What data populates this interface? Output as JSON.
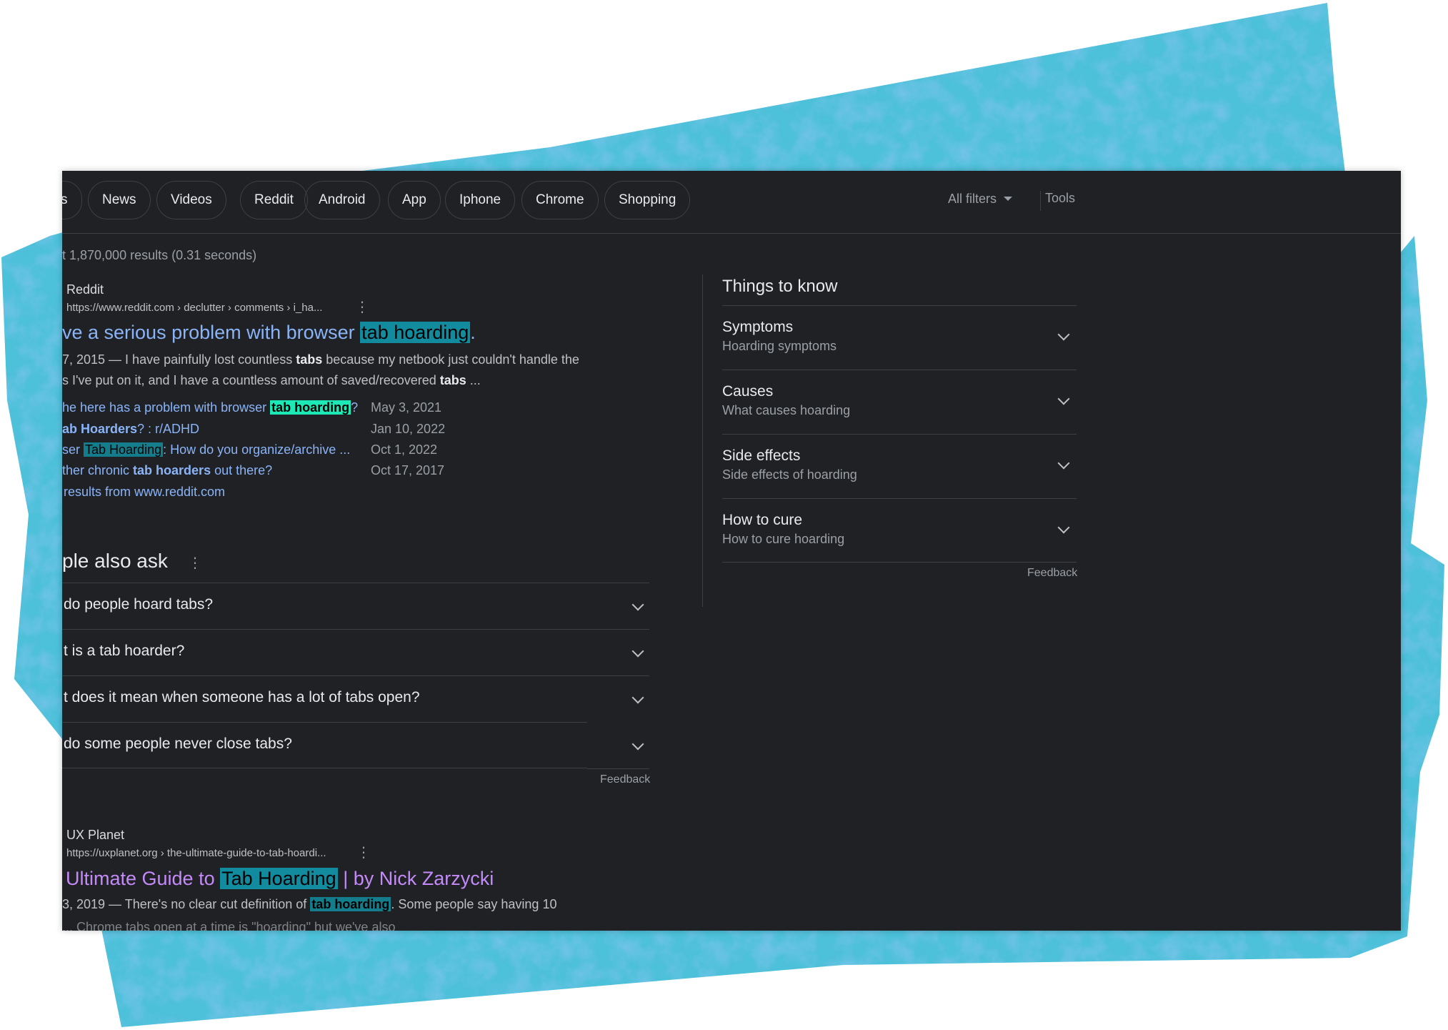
{
  "chips": [
    "s",
    "News",
    "Videos",
    "Reddit",
    "Android",
    "App",
    "Iphone",
    "Chrome",
    "Shopping"
  ],
  "toolbar": {
    "all_filters": "All filters",
    "tools": "Tools"
  },
  "result_stats": "t 1,870,000 results (0.31 seconds)",
  "result1": {
    "site": "Reddit",
    "url": "https://www.reddit.com › declutter › comments › i_ha...",
    "title_pre": "ve a serious problem with browser ",
    "title_hl": "tab hoarding",
    "title_post": ".",
    "snippet1_a": "7, 2015 — I have painfully lost countless ",
    "snippet1_b": "tabs",
    "snippet1_c": " because my netbook just couldn't handle the",
    "snippet2_a": "s I've put on it, and I have a countless amount of saved/recovered ",
    "snippet2_b": "tabs",
    "snippet2_c": " ...",
    "sublinks": [
      {
        "pre": "he here has a problem with browser ",
        "hl": "tab hoarding",
        "post": "?",
        "date": "May 3, 2021"
      },
      {
        "pre": "",
        "bold": "ab Hoarders",
        "post": "? : r/ADHD",
        "date": "Jan 10, 2022"
      },
      {
        "pre": "ser ",
        "hl": "Tab Hoarding",
        "post": ": How do you organize/archive ...",
        "date": "Oct 1, 2022"
      },
      {
        "pre": "ther chronic ",
        "bold": "tab hoarders",
        "post": " out there?",
        "date": "Oct 17, 2017"
      }
    ],
    "more": "results from www.reddit.com"
  },
  "paa": {
    "title": "ple also ask",
    "questions": [
      "do people hoard tabs?",
      "t is a tab hoarder?",
      "t does it mean when someone has a lot of tabs open?",
      "do some people never close tabs?"
    ],
    "feedback": "Feedback"
  },
  "result2": {
    "site": "UX Planet",
    "url": "https://uxplanet.org › the-ultimate-guide-to-tab-hoardi...",
    "title_pre": "Ultimate Guide to ",
    "title_hl": "Tab Hoarding",
    "title_post": " | by Nick Zarzycki",
    "snippet_a": "3, 2019 — There's no clear cut definition of ",
    "snippet_hl": "tab hoarding",
    "snippet_c": ". Some people say having 10",
    "snippet_cut": "... Chrome tabs open at a time is \"hoarding\" but we've also"
  },
  "things_to_know": {
    "title": "Things to know",
    "items": [
      {
        "heading": "Symptoms",
        "sub": "Hoarding symptoms"
      },
      {
        "heading": "Causes",
        "sub": "What causes hoarding"
      },
      {
        "heading": "Side effects",
        "sub": "Side effects of hoarding"
      },
      {
        "heading": "How to cure",
        "sub": "How to cure hoarding"
      }
    ],
    "feedback": "Feedback"
  },
  "colors": {
    "panel_bg": "#202124",
    "link": "#8ab4f8",
    "visited": "#c58af9",
    "highlight": "#128b9e",
    "highlight_green": "#1de9b6",
    "backdrop": "#45b7d6"
  },
  "icons": [
    "more-vert-icon",
    "chevron-down-icon",
    "caret-down-icon"
  ]
}
